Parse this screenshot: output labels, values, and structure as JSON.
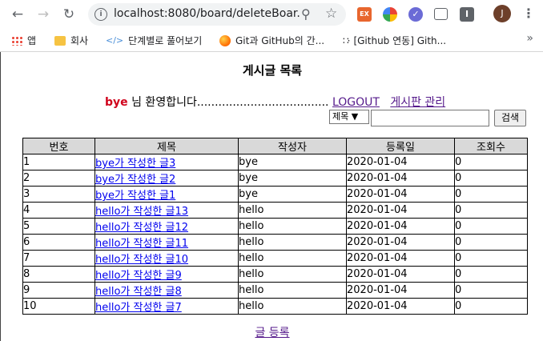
{
  "browser": {
    "url": "localhost:8080/board/deleteBoar...",
    "avatar_letter": "J",
    "ext_label": "EX",
    "ext_label2": "I",
    "bookmarks": [
      {
        "label": "앱",
        "icon": "apps-grid-icon"
      },
      {
        "label": "회사",
        "icon": "folder-icon"
      },
      {
        "label": "단계별로 풀어보기",
        "icon": "code-icon"
      },
      {
        "label": "Git과 GitHub의 간...",
        "icon": "orange-circle-icon"
      },
      {
        "label": "[Github 연동] Gith...",
        "icon": "dots-icon"
      }
    ],
    "more": "»"
  },
  "page": {
    "title": "게시글 목록",
    "welcome_user": "bye",
    "welcome_text": " 님 환영합니다.....................................",
    "logout_link": "LOGOUT",
    "admin_link": "게시판 관리",
    "search_select": "제목",
    "search_button": "검색",
    "write_link": "글 등록"
  },
  "table": {
    "headers": [
      "번호",
      "제목",
      "작성자",
      "등록일",
      "조회수"
    ],
    "rows": [
      [
        "1",
        "bye가 작성한 글3",
        "bye",
        "2020-01-04",
        "0"
      ],
      [
        "2",
        "bye가 작성한 글2",
        "bye",
        "2020-01-04",
        "0"
      ],
      [
        "3",
        "bye가 작성한 글1",
        "bye",
        "2020-01-04",
        "0"
      ],
      [
        "4",
        "hello가 작성한 글13",
        "hello",
        "2020-01-04",
        "0"
      ],
      [
        "5",
        "hello가 작성한 글12",
        "hello",
        "2020-01-04",
        "0"
      ],
      [
        "6",
        "hello가 작성한 글11",
        "hello",
        "2020-01-04",
        "0"
      ],
      [
        "7",
        "hello가 작성한 글10",
        "hello",
        "2020-01-04",
        "0"
      ],
      [
        "8",
        "hello가 작성한 글9",
        "hello",
        "2020-01-04",
        "0"
      ],
      [
        "9",
        "hello가 작성한 글8",
        "hello",
        "2020-01-04",
        "0"
      ],
      [
        "10",
        "hello가 작성한 글7",
        "hello",
        "2020-01-04",
        "0"
      ]
    ]
  },
  "colors": {
    "welcome_user": "#d0021b",
    "link_visited": "#551a8b",
    "link": "#0000ee",
    "header_bg": "#d9d9d9"
  }
}
